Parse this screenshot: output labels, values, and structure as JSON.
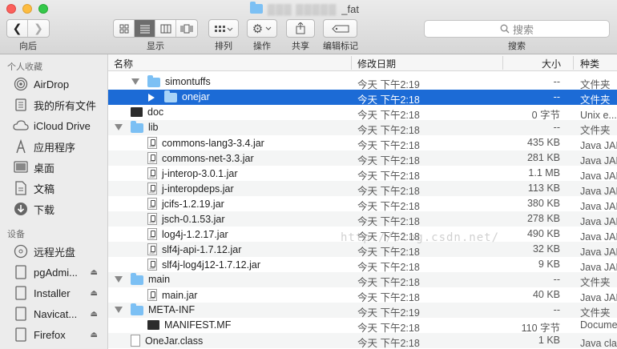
{
  "window": {
    "title_hidden": "▒▒▒ ▒▒▒▒▒",
    "title_suffix": "_fat"
  },
  "toolbar": {
    "back_forward_label": "向后",
    "view_label": "显示",
    "arrange_label": "排列",
    "action_label": "操作",
    "share_label": "共享",
    "tags_label": "编辑标记",
    "search_placeholder": "搜索",
    "search_label": "搜索"
  },
  "sidebar": {
    "favorites_header": "个人收藏",
    "favorites": [
      {
        "label": "AirDrop",
        "icon": "airdrop-icon"
      },
      {
        "label": "我的所有文件",
        "icon": "all-files-icon"
      },
      {
        "label": "iCloud Drive",
        "icon": "cloud-icon"
      },
      {
        "label": "应用程序",
        "icon": "applications-icon"
      },
      {
        "label": "桌面",
        "icon": "desktop-icon"
      },
      {
        "label": "文稿",
        "icon": "documents-icon"
      },
      {
        "label": "下载",
        "icon": "downloads-icon"
      }
    ],
    "devices_header": "设备",
    "devices": [
      {
        "label": "远程光盘",
        "icon": "disc-icon"
      },
      {
        "label": "pgAdmi...",
        "icon": "drive-icon"
      },
      {
        "label": "Installer",
        "icon": "drive-icon"
      },
      {
        "label": "Navicat...",
        "icon": "drive-icon"
      },
      {
        "label": "Firefox",
        "icon": "drive-icon"
      }
    ]
  },
  "columns": {
    "name": "名称",
    "date": "修改日期",
    "size": "大小",
    "kind": "种类"
  },
  "rows": [
    {
      "name": "simontuffs",
      "date": "今天 下午2:19",
      "size": "--",
      "kind": "文件夹"
    },
    {
      "name": "onejar",
      "date": "今天 下午2:18",
      "size": "--",
      "kind": "文件夹"
    },
    {
      "name": "doc",
      "date": "今天 下午2:18",
      "size": "0 字节",
      "kind": "Unix e...ble 文件"
    },
    {
      "name": "lib",
      "date": "今天 下午2:18",
      "size": "--",
      "kind": "文件夹"
    },
    {
      "name": "commons-lang3-3.4.jar",
      "date": "今天 下午2:18",
      "size": "435 KB",
      "kind": "Java JAR 文件"
    },
    {
      "name": "commons-net-3.3.jar",
      "date": "今天 下午2:18",
      "size": "281 KB",
      "kind": "Java JAR 文件"
    },
    {
      "name": "j-interop-3.0.1.jar",
      "date": "今天 下午2:18",
      "size": "1.1 MB",
      "kind": "Java JAR 文件"
    },
    {
      "name": "j-interopdeps.jar",
      "date": "今天 下午2:18",
      "size": "113 KB",
      "kind": "Java JAR 文件"
    },
    {
      "name": "jcifs-1.2.19.jar",
      "date": "今天 下午2:18",
      "size": "380 KB",
      "kind": "Java JAR 文件"
    },
    {
      "name": "jsch-0.1.53.jar",
      "date": "今天 下午2:18",
      "size": "278 KB",
      "kind": "Java JAR 文件"
    },
    {
      "name": "log4j-1.2.17.jar",
      "date": "今天 下午2:18",
      "size": "490 KB",
      "kind": "Java JAR 文件"
    },
    {
      "name": "slf4j-api-1.7.12.jar",
      "date": "今天 下午2:18",
      "size": "32 KB",
      "kind": "Java JAR 文件"
    },
    {
      "name": "slf4j-log4j12-1.7.12.jar",
      "date": "今天 下午2:18",
      "size": "9 KB",
      "kind": "Java JAR 文件"
    },
    {
      "name": "main",
      "date": "今天 下午2:18",
      "size": "--",
      "kind": "文件夹"
    },
    {
      "name": "main.jar",
      "date": "今天 下午2:18",
      "size": "40 KB",
      "kind": "Java JAR 文件"
    },
    {
      "name": "META-INF",
      "date": "今天 下午2:19",
      "size": "--",
      "kind": "文件夹"
    },
    {
      "name": "MANIFEST.MF",
      "date": "今天 下午2:18",
      "size": "110 字节",
      "kind": "Document"
    },
    {
      "name": "OneJar.class",
      "date": "今天 下午2:18",
      "size": "1 KB",
      "kind": "Java class 文件"
    }
  ],
  "watermark": "http://blog.csdn.net/"
}
